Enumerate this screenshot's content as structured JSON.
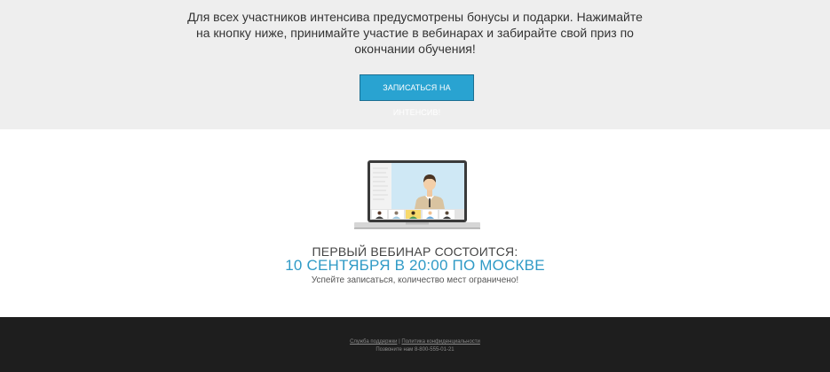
{
  "bonus": {
    "line1": "Для всех участников интенсива предусмотрены бонусы и подарки. Нажимайте",
    "line2": "на кнопку ниже, принимайте участие в вебинарах и забирайте свой приз по",
    "line3": "окончании обучения!",
    "cta_label": "ЗАПИСАТЬСЯ НА ИНТЕНСИВ!"
  },
  "webinar": {
    "intro": "ПЕРВЫЙ ВЕБИНАР СОСТОИТСЯ:",
    "date": "10 СЕНТЯБРЯ В 20:00 ПО МОСКВЕ",
    "note": "Успейте записаться, количество мест ограничено!"
  },
  "footer": {
    "support_link": "Служба поддержки",
    "separator": " | ",
    "privacy_link": "Политика конфиденциальности",
    "phone_text": "Позвоните нам 8-800-555-01-21"
  },
  "colors": {
    "accent": "#2f9ac6",
    "button": "#29a3d1",
    "top_bg": "#eeeeee",
    "footer_bg": "#1e1e1e"
  }
}
